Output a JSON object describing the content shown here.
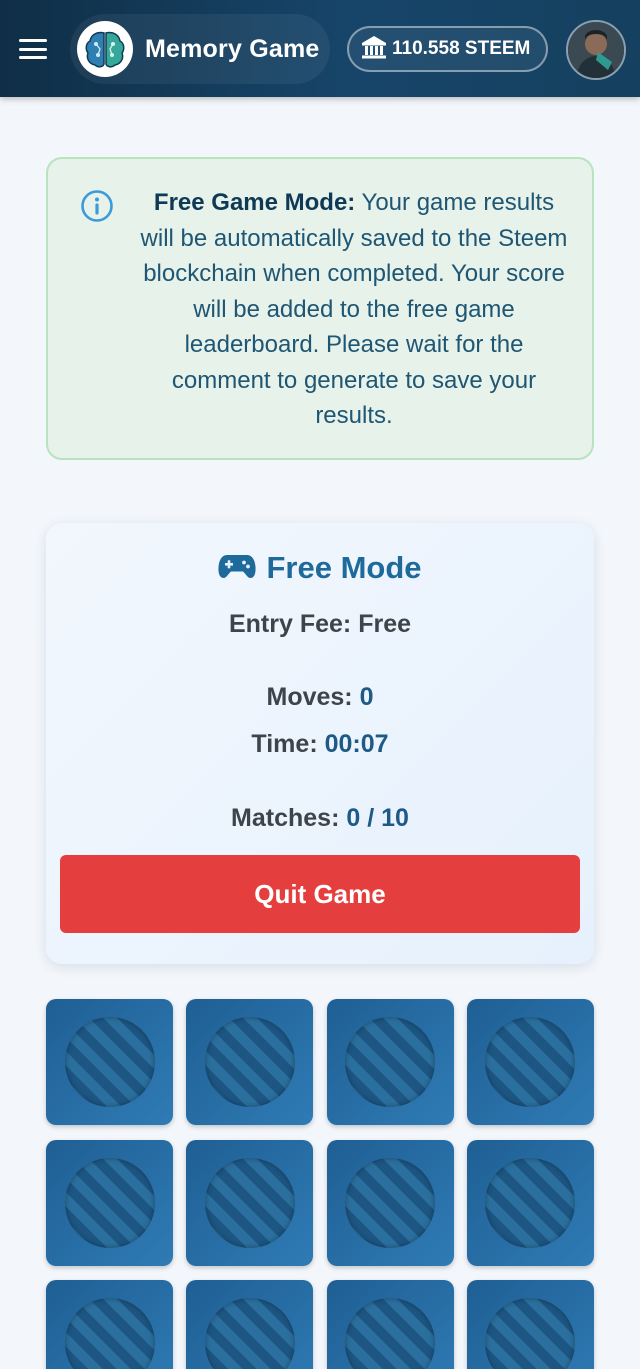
{
  "header": {
    "app_title": "Memory Game",
    "balance": "110.558 STEEM"
  },
  "info": {
    "heading": "Free Game Mode:",
    "message": " Your game results will be automatically saved to the Steem blockchain when completed. Your score will be added to the free game leaderboard. Please wait for the comment to generate to save your results."
  },
  "game": {
    "mode_title": "Free Mode",
    "entry_fee_label": "Entry Fee:",
    "entry_fee_value": "Free",
    "moves_label": "Moves:",
    "moves_value": "0",
    "time_label": "Time:",
    "time_value": "00:07",
    "matches_label": "Matches:",
    "matches_value": "0 / 10",
    "quit_label": "Quit Game"
  },
  "board": {
    "face_down_cards": 12
  },
  "colors": {
    "header": "#17456a",
    "accent": "#1e6a9b",
    "danger": "#e53e3e",
    "info_bg": "#e6f2ea",
    "info_border": "#b8e3bf"
  }
}
